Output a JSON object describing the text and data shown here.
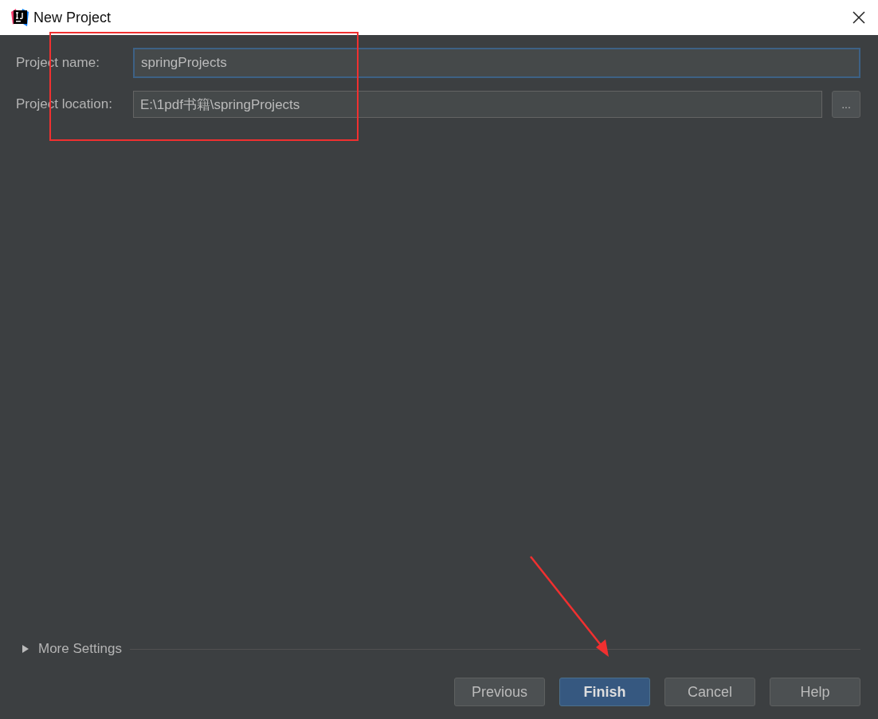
{
  "window": {
    "title": "New Project"
  },
  "fields": [
    {
      "label": "Project name:",
      "value": "springProjects",
      "focused": true,
      "browse": false
    },
    {
      "label": "Project location:",
      "value": "E:\\1pdf书籍\\springProjects",
      "focused": false,
      "browse": true,
      "browse_label": "..."
    }
  ],
  "more_settings": {
    "label": "More Settings",
    "expanded": false
  },
  "buttons": [
    {
      "label": "Previous",
      "default": false
    },
    {
      "label": "Finish",
      "default": true
    },
    {
      "label": "Cancel",
      "default": false
    },
    {
      "label": "Help",
      "default": false
    }
  ]
}
